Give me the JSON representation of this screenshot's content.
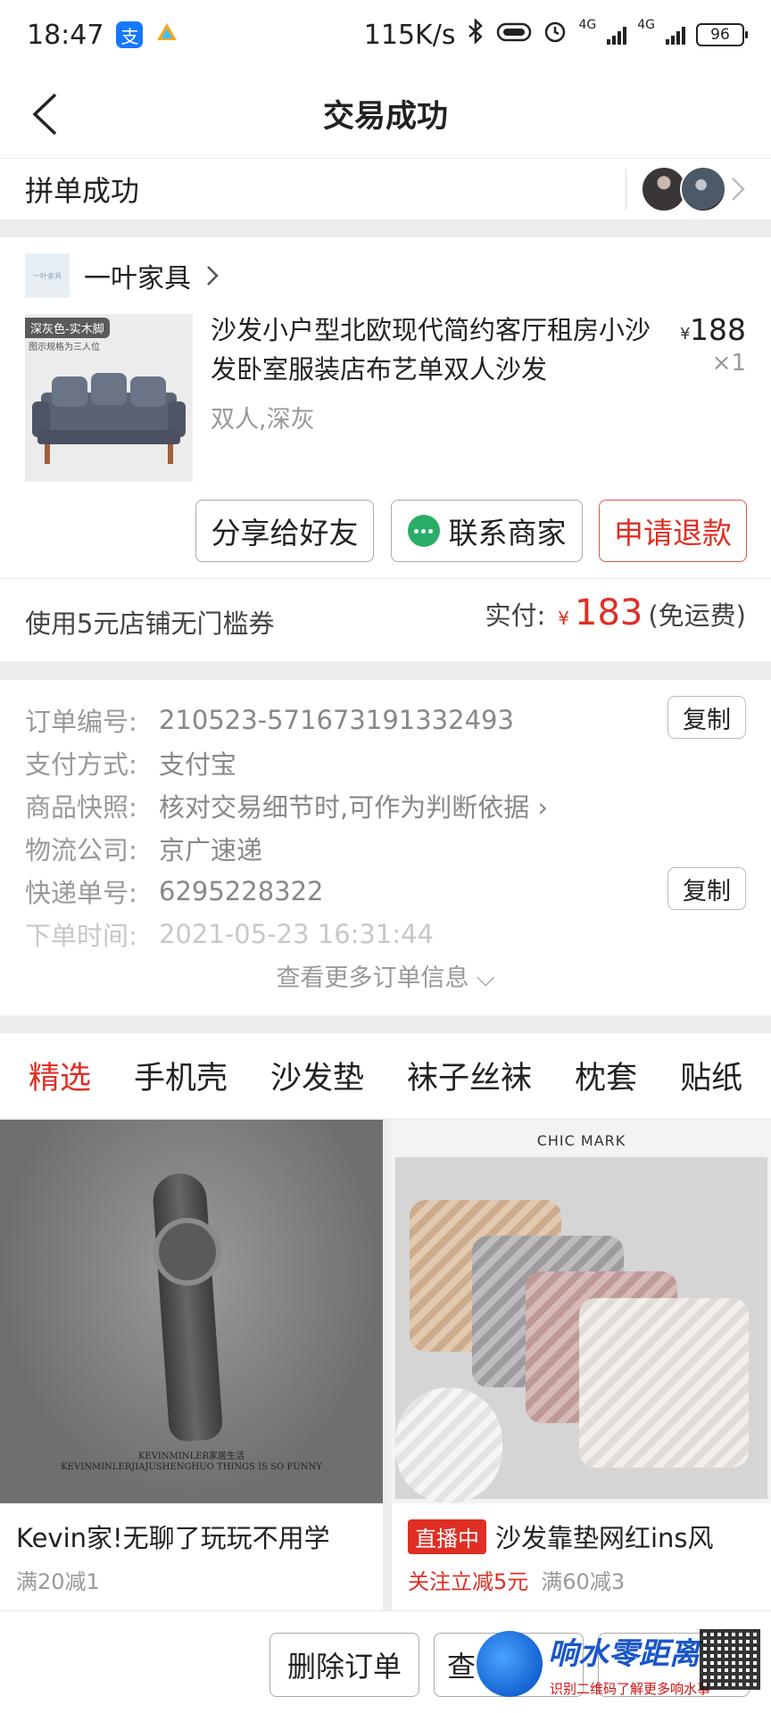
{
  "status_bar": {
    "time": "18:47",
    "net_speed": "115K/s",
    "net_tag_1": "4G",
    "net_tag_2": "4G",
    "battery": "96"
  },
  "header": {
    "title": "交易成功"
  },
  "group": {
    "text": "拼单成功"
  },
  "shop": {
    "logo_text": "一叶家具",
    "name": "一叶家具",
    "chevron": "›"
  },
  "product": {
    "image_tag": "深灰色-实木脚",
    "image_note": "图示规格为三人位",
    "title": "沙发小户型北欧现代简约客厅租房小沙发卧室服装店布艺单双人沙发",
    "spec": "双人,深灰",
    "price_symbol": "¥",
    "price": "188",
    "qty": "×1"
  },
  "actions": {
    "share": "分享给好友",
    "contact": "联系商家",
    "refund": "申请退款"
  },
  "payment": {
    "coupon": "使用5元店铺无门槛券",
    "label": "实付:",
    "symbol": "¥",
    "amount": "183",
    "note": "(免运费)"
  },
  "order_info": {
    "order_no_label": "订单编号:",
    "order_no": "210523-571673191332493",
    "pay_method_label": "支付方式:",
    "pay_method": "支付宝",
    "snapshot_label": "商品快照:",
    "snapshot": "核对交易细节时,可作为判断依据 ›",
    "logistics_label": "物流公司:",
    "logistics": "京广速递",
    "tracking_label": "快递单号:",
    "tracking": "6295228322",
    "time_label": "下单时间:",
    "time": "2021-05-23 16:31:44",
    "copy": "复制",
    "more": "查看更多订单信息 ⌵"
  },
  "tabs": [
    "精选",
    "手机壳",
    "沙发垫",
    "袜子丝袜",
    "枕套",
    "贴纸"
  ],
  "recommend": {
    "left": {
      "caption1": "KEVINMINLER家居生活",
      "caption2": "KEVINMINLERJIAJUSHENGHUO THINGS IS SO FUNNY",
      "title": "Kevin家!无聊了玩玩不用学",
      "sub": "满20减1"
    },
    "right": {
      "brand": "CHIC MARK",
      "live_tag": "直播中",
      "title": "沙发靠垫网红ins风",
      "sub_red": "关注立减5元",
      "sub": "满60减3"
    }
  },
  "bottom": {
    "delete": "删除订单",
    "logistics": "查",
    "third": "",
    "watermark_text": "响水零距离",
    "watermark_sub": "识别二维码了解更多响水事"
  },
  "colors": {
    "accent": "#e02e24",
    "wechat": "#2aae67",
    "alipay": "#1677ff"
  }
}
